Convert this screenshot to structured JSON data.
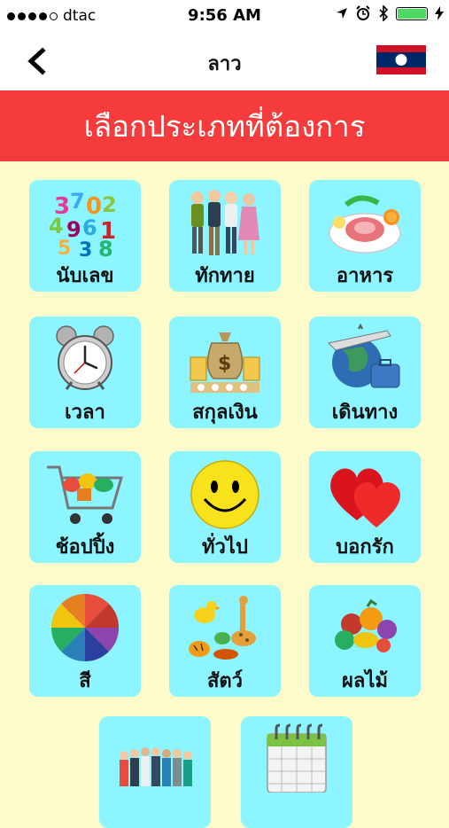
{
  "status": {
    "carrier": "dtac",
    "time": "9:56 AM"
  },
  "nav": {
    "title": "ลาว",
    "flag": "laos-flag",
    "back_icon": "chevron-left-icon"
  },
  "banner": {
    "text": "เลือกประเภทที่ต้องการ"
  },
  "categories": [
    {
      "label": "นับเลข",
      "icon": "numbers-icon"
    },
    {
      "label": "ทักทาย",
      "icon": "greeting-people-icon"
    },
    {
      "label": "อาหาร",
      "icon": "food-plate-icon"
    },
    {
      "label": "เวลา",
      "icon": "alarm-clock-icon"
    },
    {
      "label": "สกุลเงิน",
      "icon": "money-bag-icon"
    },
    {
      "label": "เดินทาง",
      "icon": "travel-globe-icon"
    },
    {
      "label": "ช้อปปิ้ง",
      "icon": "shopping-cart-icon"
    },
    {
      "label": "ทั่วไป",
      "icon": "smiley-icon"
    },
    {
      "label": "บอกรัก",
      "icon": "hearts-icon"
    },
    {
      "label": "สี",
      "icon": "color-wheel-icon"
    },
    {
      "label": "สัตว์",
      "icon": "animals-icon"
    },
    {
      "label": "ผลไม้",
      "icon": "fruits-icon"
    },
    {
      "label": "",
      "icon": "occupations-people-icon"
    },
    {
      "label": "",
      "icon": "calendar-icon"
    }
  ]
}
